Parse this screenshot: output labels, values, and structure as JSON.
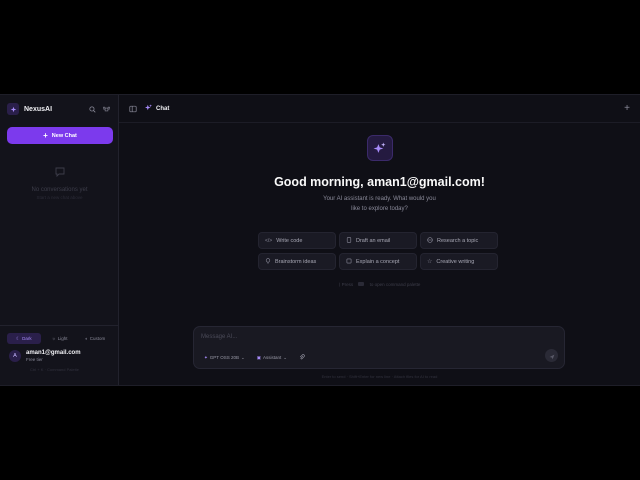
{
  "sidebar": {
    "brand": "NexusAI",
    "new_chat": "New Chat",
    "empty_title": "No conversations yet",
    "empty_hint": "Start a new chat above",
    "themes": [
      "Dark",
      "Light",
      "Custom"
    ],
    "user": {
      "initial": "A",
      "email": "aman1@gmail.com",
      "plan": "Free tier"
    },
    "shortcut": "Ctrl + K · Command Palette"
  },
  "topbar": {
    "title": "Chat"
  },
  "hero": {
    "greeting": "Good morning, aman1@gmail.com!",
    "subtitle": "Your AI assistant is ready. What would you like to explore today?"
  },
  "suggestions": [
    "Write code",
    "Draft an email",
    "Research a topic",
    "Brainstorm ideas",
    "Explain a concept",
    "Creative writing"
  ],
  "palette_hint": {
    "before": "Press",
    "after": "to open command palette"
  },
  "composer": {
    "placeholder": "Message AI...",
    "model": "GPT OSS 20B",
    "mode": "Assistant"
  },
  "footer": "Enter to send · Shift+Enter for new line · Attach files for AI to read",
  "colors": {
    "accent": "#7c3aed",
    "background": "#0f0f16",
    "sidebar": "#13131b"
  }
}
